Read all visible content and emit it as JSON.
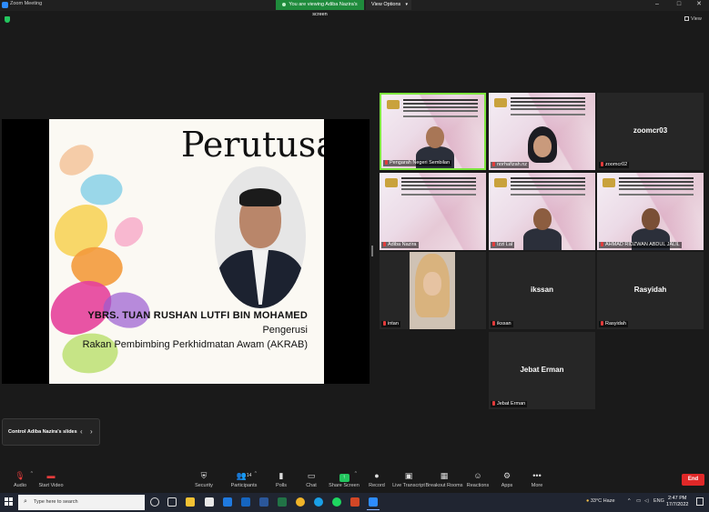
{
  "window": {
    "title": "Zoom Meeting",
    "viewing_banner": "You are viewing Adiba Nazira's screen",
    "view_options": "View Options",
    "view_toggle": "View"
  },
  "shared_slide": {
    "title": "Perutusan",
    "name": "YBRS. TUAN RUSHAN LUTFI BIN MOHAMED",
    "role": "Pengerusi",
    "organization": "Rakan Pembimbing Perkhidmatan Awam (AKRAB)"
  },
  "gallery": [
    {
      "label": "Pengarah Negeri Sembilan",
      "type": "video",
      "active": true
    },
    {
      "label": "norhafizah.nz",
      "type": "video-hijab"
    },
    {
      "label": "zoomcr02",
      "center": "zoomcr03",
      "type": "name"
    },
    {
      "label": "Adiba Nazira",
      "type": "video-empty"
    },
    {
      "label": "Izzi Lal",
      "type": "video"
    },
    {
      "label": "AHMAD RIDZWAN ABDUL JALIL",
      "type": "video"
    },
    {
      "label": "intan",
      "type": "photo"
    },
    {
      "label": "ikssan",
      "center": "ikssan",
      "type": "name"
    },
    {
      "label": "Rasyidah",
      "center": "Rasyidah",
      "type": "name"
    },
    {
      "label": "Jebat Erman",
      "center": "Jebat Erman",
      "type": "name"
    }
  ],
  "control": {
    "label": "Control Adiba Nazira's slides",
    "prev": "‹",
    "next": "›"
  },
  "toolbar": {
    "audio": "Audio",
    "start_video": "Start Video",
    "security": "Security",
    "participants": "Participants",
    "participants_count": "14",
    "polls": "Polls",
    "chat": "Chat",
    "share_screen": "Share Screen",
    "record": "Record",
    "live_transcript": "Live Transcript",
    "breakout_rooms": "Breakout Rooms",
    "reactions": "Reactions",
    "apps": "Apps",
    "more": "More",
    "end": "End"
  },
  "taskbar": {
    "search_placeholder": "Type here to search",
    "weather": "33°C  Haze",
    "language": "ENG",
    "time": "2:47 PM",
    "date": "17/7/2022"
  },
  "colors": {
    "active_speaker": "#7ee53f",
    "end_button": "#e02828",
    "share_green": "#23c55e",
    "viewing_banner": "#1f8b3c"
  }
}
